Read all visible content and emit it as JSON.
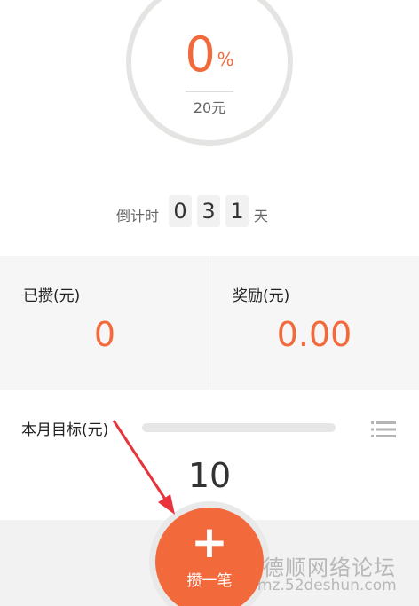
{
  "progress": {
    "percent_value": "0",
    "percent_symbol": "%",
    "goal_amount": "20元",
    "ring_fill": 0.0
  },
  "countdown": {
    "label": "倒计时",
    "digits": [
      "0",
      "3",
      "1"
    ],
    "unit": "天"
  },
  "stats": {
    "saved_label": "已攒(元)",
    "saved_value": "0",
    "reward_label": "奖励(元)",
    "reward_value": "0.00"
  },
  "target": {
    "label": "本月目标(元)",
    "value": "10",
    "progress_fraction": 0.0
  },
  "fab": {
    "plus": "+",
    "label": "攒一笔"
  },
  "watermark": {
    "cn_text": "德顺网络论坛",
    "url_text": "mz.52deshun.com"
  },
  "colors": {
    "accent": "#f26a3c",
    "ring": "#e4e4e2",
    "annotation_arrow": "#e8323c"
  },
  "icons": {
    "list": "list-icon"
  }
}
